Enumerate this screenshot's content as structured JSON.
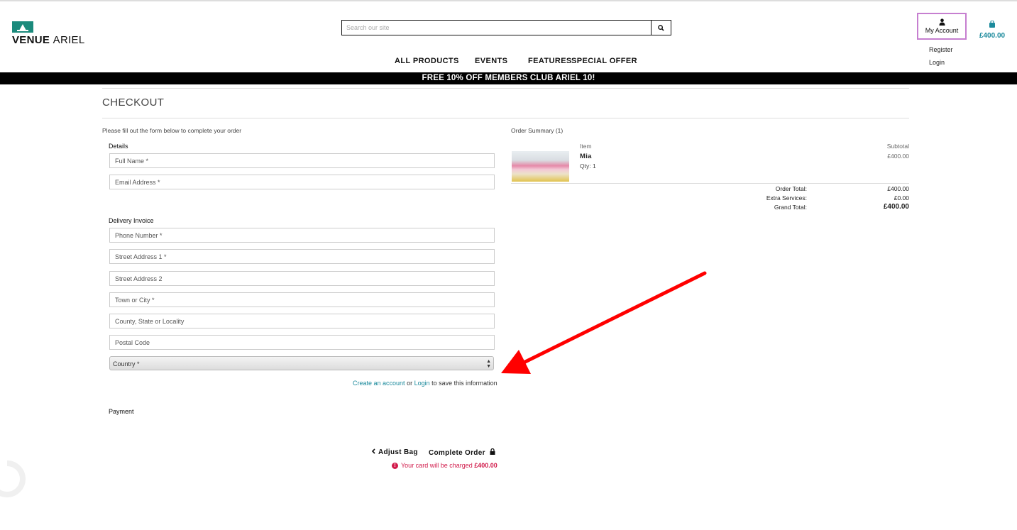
{
  "brand": {
    "name_bold": "VENUE",
    "name_light": "ARIEL"
  },
  "search": {
    "placeholder": "Search our site"
  },
  "nav": [
    "ALL PRODUCTS",
    "EVENTS",
    "FEATURES",
    "SPECIAL OFFER"
  ],
  "account": {
    "label": "My Account",
    "links": [
      "Register",
      "Login"
    ]
  },
  "bag": {
    "total": "£400.00"
  },
  "banner": "FREE 10% OFF MEMBERS CLUB ARIEL 10!",
  "checkout": {
    "title": "CHECKOUT",
    "instructions": "Please fill out the form below to complete your order",
    "details_heading": "Details",
    "details_fields": [
      "Full Name *",
      "Email Address *"
    ],
    "delivery_heading": "Delivery Invoice",
    "delivery_fields": [
      "Phone Number *",
      "Street Address 1 *",
      "Street Address 2",
      "Town or City *",
      "County, State or Locality",
      "Postal Code"
    ],
    "country_select": "Country *",
    "save_info": {
      "create_link": "Create an account",
      "or": "or",
      "login_link": "Login",
      "suffix": "to save this information"
    },
    "payment_heading": "Payment",
    "adjust_bag": "Adjust Bag",
    "complete_order": "Complete Order",
    "charge_notice": "Your card will be charged",
    "charge_amount": "£400.00"
  },
  "summary": {
    "title": "Order Summary (1)",
    "col_item": "Item",
    "col_subtotal": "Subtotal",
    "product_name": "Mia",
    "product_qty": "Qty: 1",
    "product_subtotal": "£400.00",
    "order_total_label": "Order Total:",
    "order_total": "£400.00",
    "extra_label": "Extra Services:",
    "extra": "£0.00",
    "grand_label": "Grand Total:",
    "grand": "£400.00"
  },
  "colors": {
    "accent": "#1b8a9c",
    "brand_green": "#1b8a7c",
    "error": "#d11a4a",
    "arrow": "#ff0000",
    "account_border": "#c67fd0"
  }
}
